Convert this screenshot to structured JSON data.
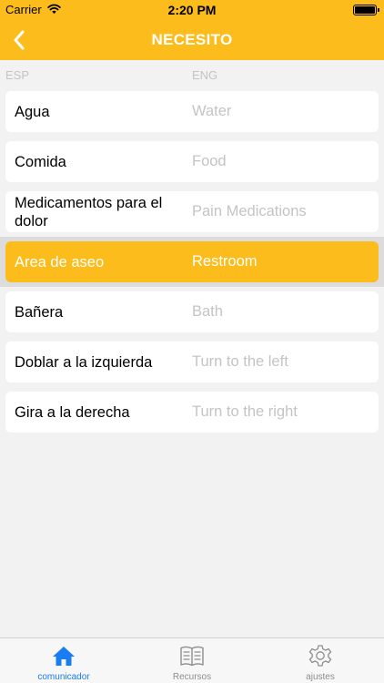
{
  "status_bar": {
    "carrier": "Carrier",
    "time": "2:20 PM"
  },
  "header": {
    "title": "NECESITO"
  },
  "columns": {
    "esp": "ESP",
    "eng": "ENG"
  },
  "items": [
    {
      "esp": "Agua",
      "eng": "Water",
      "selected": false
    },
    {
      "esp": "Comida",
      "eng": "Food",
      "selected": false
    },
    {
      "esp": "Medicamentos para el dolor",
      "eng": "Pain Medications",
      "selected": false
    },
    {
      "esp": "Area de aseo",
      "eng": "Restroom",
      "selected": true
    },
    {
      "esp": "Bañera",
      "eng": "Bath",
      "selected": false
    },
    {
      "esp": "Doblar a la izquierda",
      "eng": "Turn to the left",
      "selected": false
    },
    {
      "esp": "Gira a la derecha",
      "eng": "Turn to the right",
      "selected": false
    }
  ],
  "tabs": [
    {
      "label": "comunicador",
      "icon": "home-icon",
      "active": true
    },
    {
      "label": "Recursos",
      "icon": "book-icon",
      "active": false
    },
    {
      "label": "ajustes",
      "icon": "gear-icon",
      "active": false
    }
  ],
  "colors": {
    "accent": "#fbbc1c",
    "tab_active": "#1a7cf2",
    "secondary_text": "#c4c4c4"
  }
}
